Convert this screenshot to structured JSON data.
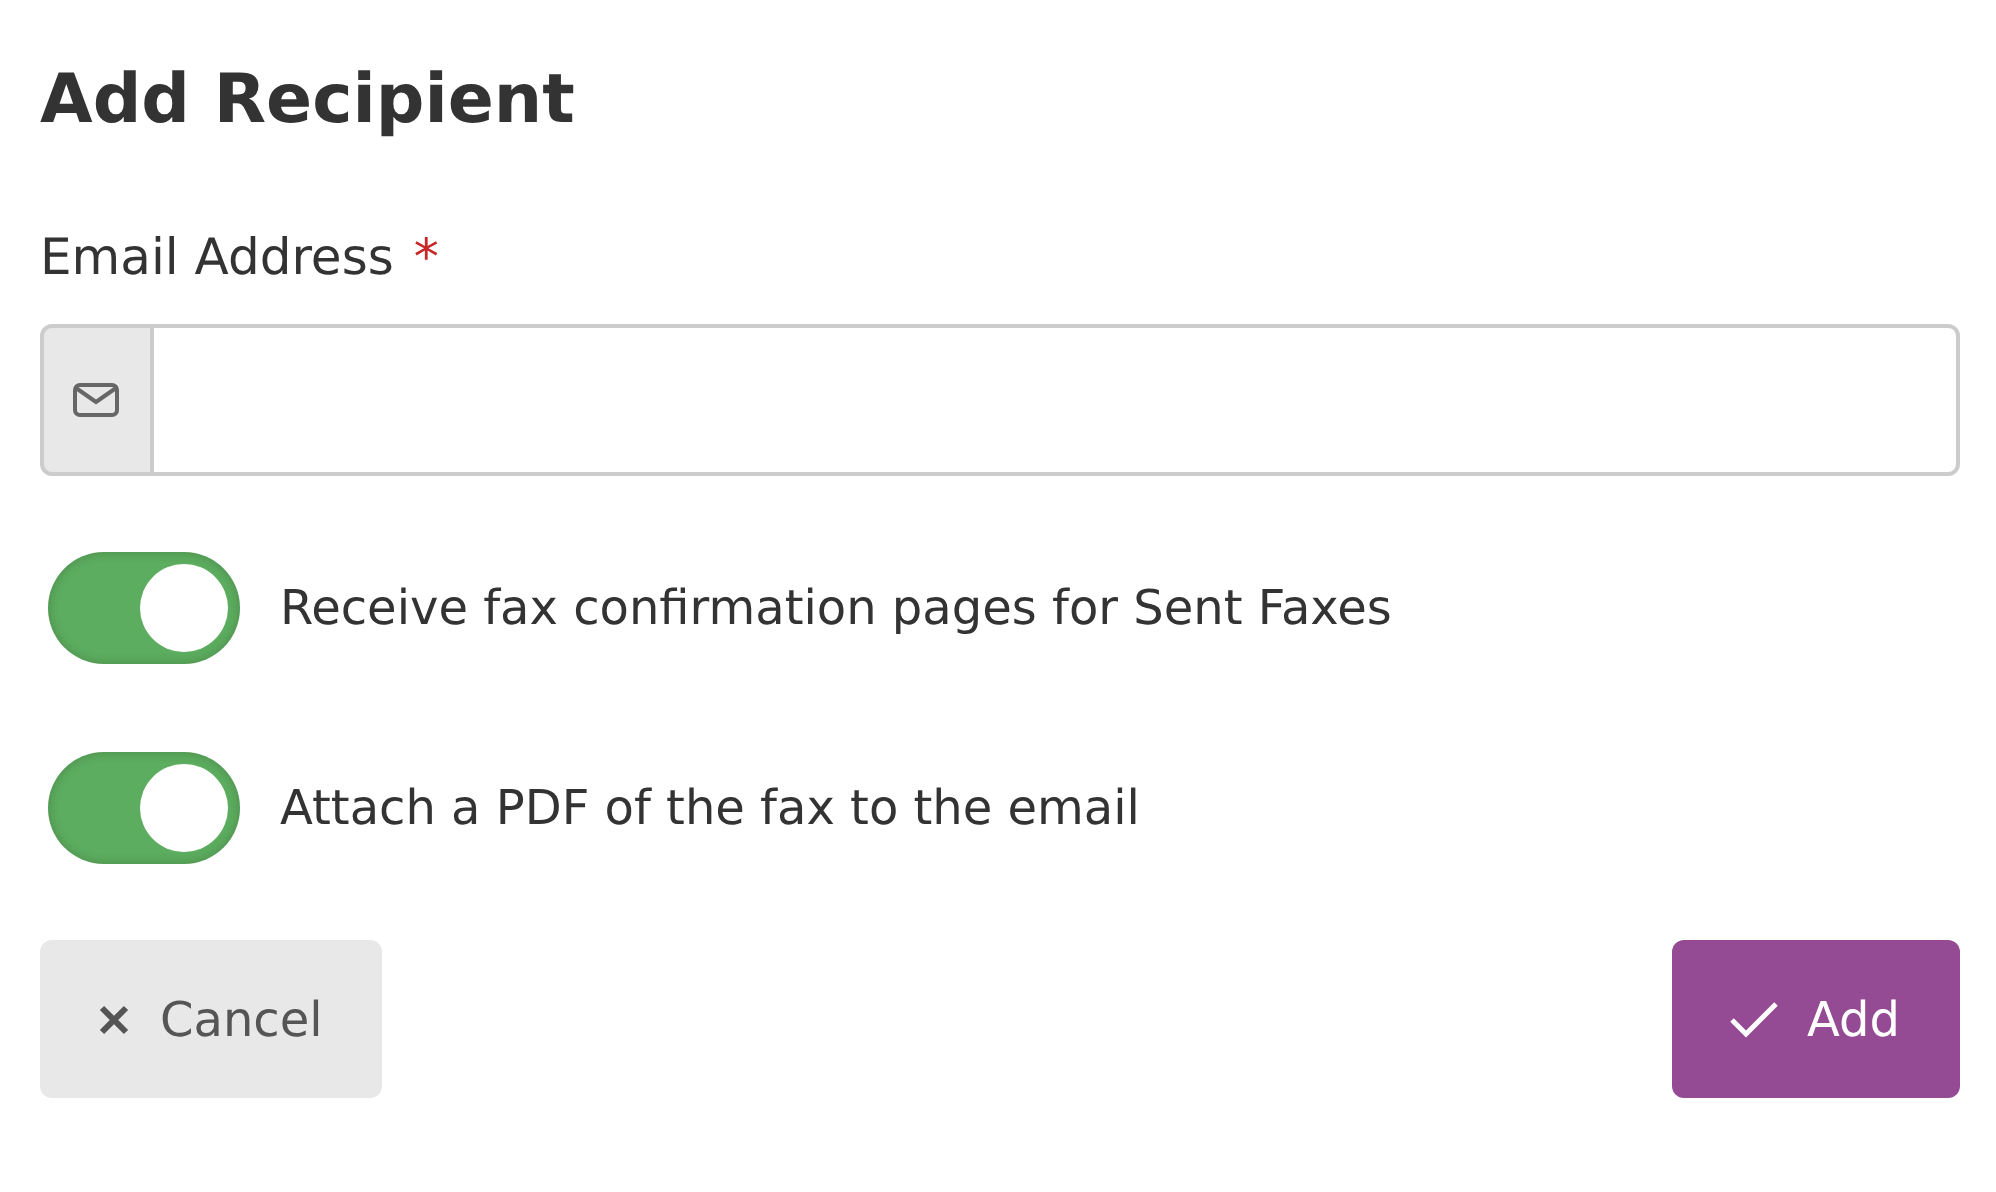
{
  "title": "Add Recipient",
  "email_field": {
    "label": "Email Address",
    "required_mark": "*"
  },
  "options": [
    {
      "label": "Receive fax confirmation pages for Sent Faxes",
      "on": true
    },
    {
      "label": "Attach a PDF of the fax to the email",
      "on": true
    }
  ],
  "buttons": [
    {
      "kind": "cancel",
      "label": "Cancel"
    },
    {
      "kind": "confirm",
      "label": "Add"
    }
  ]
}
